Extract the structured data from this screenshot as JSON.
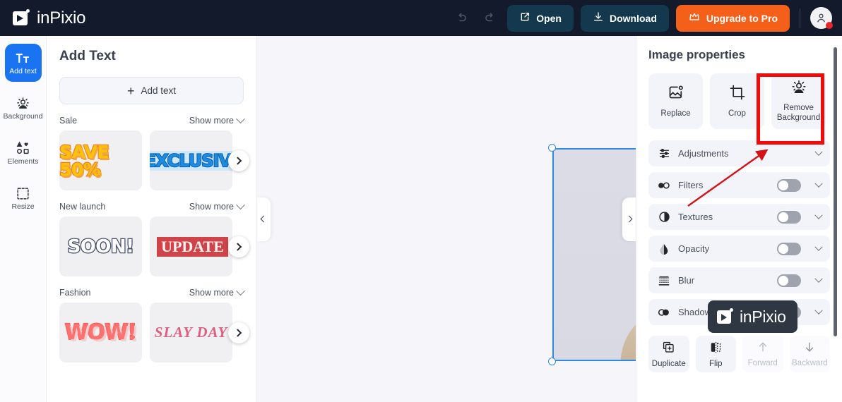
{
  "app": {
    "brand": "inPixio"
  },
  "topbar": {
    "undo_icon": "undo-icon",
    "redo_icon": "redo-icon",
    "open_label": "Open",
    "download_label": "Download",
    "upgrade_label": "Upgrade to Pro",
    "avatar_icon": "user-avatar-icon",
    "accent_orange": "#f4601a",
    "button_dark": "#14394e",
    "bar_bg": "#131a2b"
  },
  "rail": {
    "items": [
      {
        "label": "Add text",
        "icon": "text-tool-icon",
        "active": true
      },
      {
        "label": "Background",
        "icon": "background-icon",
        "active": false
      },
      {
        "label": "Elements",
        "icon": "elements-icon",
        "active": false
      },
      {
        "label": "Resize",
        "icon": "resize-icon",
        "active": false
      }
    ],
    "active_color": "#1a73f0"
  },
  "left_panel": {
    "title": "Add Text",
    "add_text_button": "Add text",
    "sections": [
      {
        "name": "Sale",
        "show_more": "Show more",
        "presets": [
          "SAVE 50%",
          "EXCLUSIVE"
        ]
      },
      {
        "name": "New launch",
        "show_more": "Show more",
        "presets": [
          "SOON!",
          "UPDATE"
        ]
      },
      {
        "name": "Fashion",
        "show_more": "Show more",
        "presets": [
          "WOW!",
          "SLAY DAY"
        ]
      }
    ]
  },
  "canvas": {
    "collapse_left_icon": "chevron-left-icon",
    "collapse_right_icon": "chevron-right-icon",
    "watermark_text": "inPixio",
    "selection_color": "#2a8ae4",
    "background": "#f6f6fa"
  },
  "right_panel": {
    "title": "Image properties",
    "tools": [
      {
        "label": "Replace",
        "icon": "replace-image-icon",
        "highlighted": false
      },
      {
        "label": "Crop",
        "icon": "crop-icon",
        "highlighted": false
      },
      {
        "label": "Remove Background",
        "icon": "remove-background-icon",
        "highlighted": true
      }
    ],
    "properties": [
      {
        "label": "Adjustments",
        "icon": "sliders-icon",
        "has_toggle": false,
        "toggle_on": false
      },
      {
        "label": "Filters",
        "icon": "filters-icon",
        "has_toggle": true,
        "toggle_on": false
      },
      {
        "label": "Textures",
        "icon": "textures-icon",
        "has_toggle": true,
        "toggle_on": false
      },
      {
        "label": "Opacity",
        "icon": "opacity-drop-icon",
        "has_toggle": true,
        "toggle_on": false
      },
      {
        "label": "Blur",
        "icon": "blur-icon",
        "has_toggle": true,
        "toggle_on": false
      },
      {
        "label": "Shadows",
        "icon": "shadows-icon",
        "has_toggle": true,
        "toggle_on": false
      }
    ],
    "order_buttons": [
      {
        "label": "Duplicate",
        "icon": "duplicate-icon",
        "disabled": false
      },
      {
        "label": "Flip",
        "icon": "flip-icon",
        "disabled": false
      },
      {
        "label": "Forward",
        "icon": "arrow-up-icon",
        "disabled": true
      },
      {
        "label": "Backward",
        "icon": "arrow-down-icon",
        "disabled": true
      }
    ]
  },
  "annotation": {
    "highlight_color": "#f00a0a",
    "target": "Remove Background"
  }
}
